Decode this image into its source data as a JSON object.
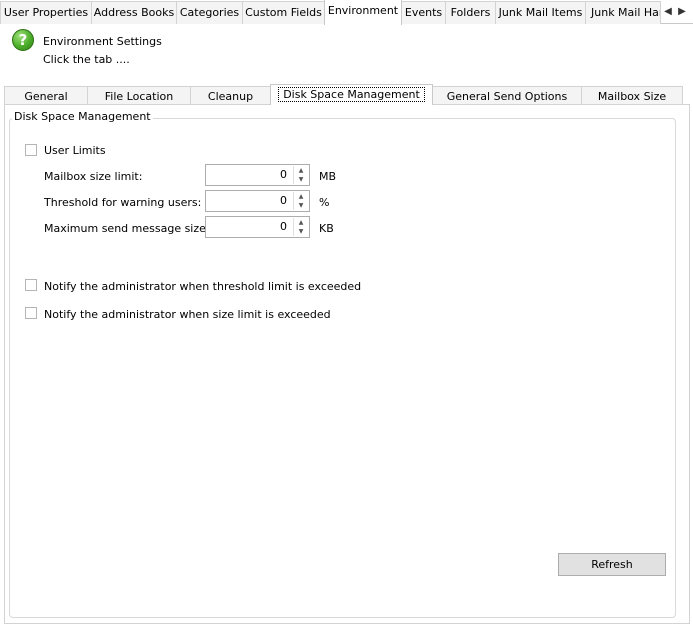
{
  "top_tabs": [
    {
      "label": "User Properties"
    },
    {
      "label": "Address Books"
    },
    {
      "label": "Categories"
    },
    {
      "label": "Custom Fields"
    },
    {
      "label": "Environment",
      "active": true
    },
    {
      "label": "Events"
    },
    {
      "label": "Folders"
    },
    {
      "label": "Junk Mail Items"
    },
    {
      "label": "Junk Mail Har"
    }
  ],
  "tab_scroll": {
    "left": "◀",
    "right": "▶"
  },
  "header": {
    "icon": "help-icon",
    "icon_glyph": "?",
    "title": "Environment Settings",
    "subtitle": "Click the tab ...."
  },
  "inner_tabs": [
    {
      "label": "General"
    },
    {
      "label": "File Location"
    },
    {
      "label": "Cleanup"
    },
    {
      "label": "Disk Space Management",
      "active": true
    },
    {
      "label": "General Send Options"
    },
    {
      "label": "Mailbox Size"
    }
  ],
  "group": {
    "title": "Disk Space Management",
    "user_limits": {
      "label": "User Limits",
      "checked": false
    },
    "fields": [
      {
        "label": "Mailbox size limit:",
        "value": "0",
        "unit": "MB"
      },
      {
        "label": "Threshold for warning users:",
        "value": "0",
        "unit": "%"
      },
      {
        "label": "Maximum send message size:",
        "value": "0",
        "unit": "KB"
      }
    ],
    "notify_threshold": {
      "label": "Notify the administrator when threshold limit is exceeded",
      "checked": false
    },
    "notify_size": {
      "label": "Notify the administrator when size limit is exceeded",
      "checked": false
    }
  },
  "refresh_label": "Refresh",
  "colors": {
    "accent_green": "#4cae2a",
    "tab_bg": "#f4f4f4",
    "border": "#d3d3d3"
  }
}
